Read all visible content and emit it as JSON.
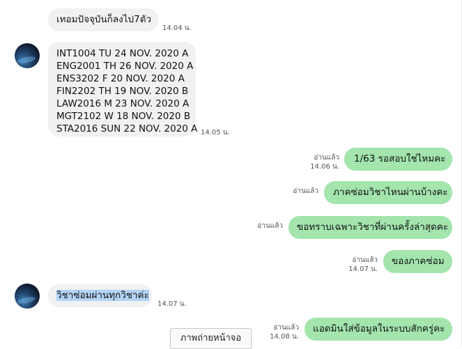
{
  "messages": {
    "m1": {
      "text": "เทอมปัจจุบันก็ลงไป7ตัว",
      "time": "14.04 น."
    },
    "m2": {
      "lines": [
        "INT1004 TU 24 NOV. 2020 A",
        "ENG2001 TH 26 NOV. 2020 A",
        "ENS3202 F 20 NOV. 2020 A",
        "FIN2202 TH 19 NOV. 2020 B",
        "LAW2016 M 23 NOV. 2020 A",
        "MGT2102 W 18 NOV. 2020 B",
        "STA2016 SUN 22 NOV. 2020 A"
      ],
      "time": "14.05 น."
    },
    "m3": {
      "text": "1/63 รอสอบใช่ไหมคะ",
      "read": "อ่านแล้ว",
      "time": "14.06 น."
    },
    "m4": {
      "text": "ภาคซ่อมวิชาไหนผ่านบ้างคะ",
      "read": "อ่านแล้ว"
    },
    "m5": {
      "text": "ขอทราบเฉพาะวิชาที่ผ่านครั้งล่าสุดคะ",
      "read": "อ่านแล้ว"
    },
    "m6": {
      "text": "ของภาคซ่อม",
      "read": "อ่านแล้ว",
      "time": "14.07 น."
    },
    "m7": {
      "text": "วิชาซ่อมผ่านทุกวิชาค่ะ",
      "time": "14.07 น."
    },
    "m8": {
      "text": "แอดมินใส่ข้อมูลในระบบสักครู่คะ",
      "read": "อ่านแล้ว",
      "time": "14.08 น."
    }
  },
  "screenshot_button": {
    "label": "ภาพถ่ายหน้าจอ"
  },
  "colors": {
    "incoming_bubble": "#f0f1f3",
    "outgoing_bubble": "#a3e5ad",
    "selection_highlight": "#b3d3f5"
  }
}
